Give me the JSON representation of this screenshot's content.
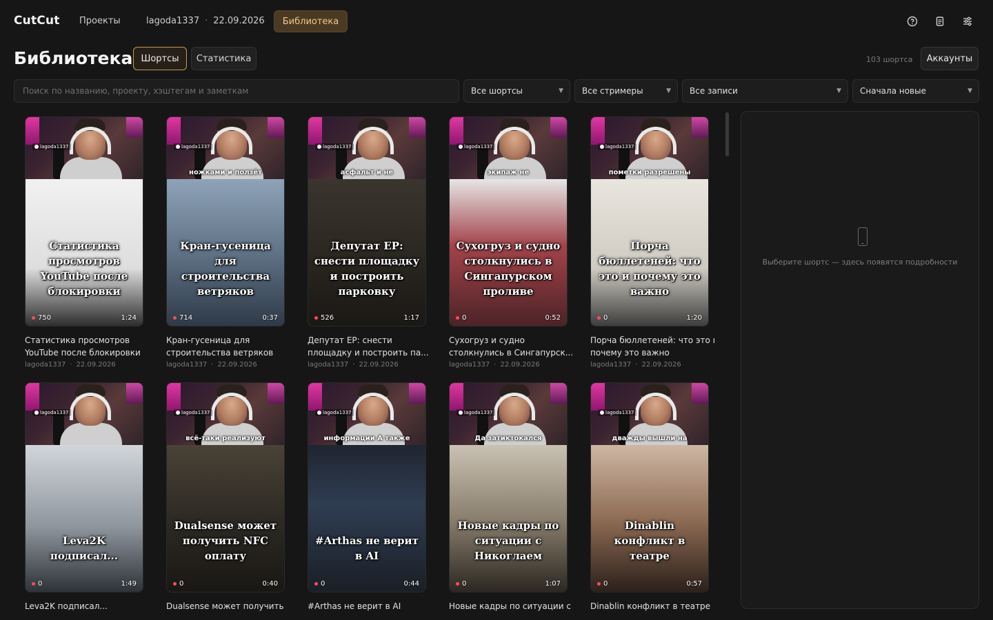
{
  "app": {
    "name": "CutCut"
  },
  "nav": {
    "projects": "Проекты",
    "account": "lagoda1337",
    "date": "22.09.2026",
    "library": "Библиотека"
  },
  "header": {
    "title": "Библиотека",
    "tabs": [
      "Шортсы",
      "Статистика"
    ],
    "count": "103 шортса",
    "accounts_button": "Аккаунты"
  },
  "filters": {
    "search_placeholder": "Поиск по названию, проекту, хэштегам и заметкам",
    "shorts": "Все шортсы",
    "streamers": "Все стримеры",
    "records": "Все записи",
    "sort": "Сначала новые"
  },
  "cards": [
    {
      "strip": "",
      "caption": "Статистика просмотров YouTube после блокировки",
      "views": "750",
      "duration": "1:24",
      "title": "Статистика просмотров YouTube после блокировки",
      "author": "lagoda1337",
      "date": "22.09.2026"
    },
    {
      "strip": "ножками и ползёт",
      "caption": "Кран-гусеница для строительства ветряков",
      "views": "714",
      "duration": "0:37",
      "title": "Кран-гусеница для строительства ветряков",
      "author": "lagoda1337",
      "date": "22.09.2026"
    },
    {
      "strip": "асфальт и не",
      "caption": "Депутат ЕР: снести площадку и построить парковку",
      "views": "526",
      "duration": "1:17",
      "title": "Депутат ЕР: снести площадку и построить па...",
      "author": "lagoda1337",
      "date": "22.09.2026"
    },
    {
      "strip": "экипаж не",
      "caption": "Сухогруз и судно столкнулись в Сингапурском проливе",
      "views": "0",
      "duration": "0:52",
      "title": "Сухогруз и судно столкнулись в Сингапурск...",
      "author": "lagoda1337",
      "date": "22.09.2026"
    },
    {
      "strip": "пометки разрешены",
      "caption": "Порча бюллетеней: что это и почему это важно",
      "views": "0",
      "duration": "1:20",
      "title": "Порча бюллетеней: что это и почему это важно",
      "author": "lagoda1337",
      "date": "22.09.2026"
    },
    {
      "strip": "",
      "caption": "Leva2K подписал...",
      "views": "0",
      "duration": "1:49",
      "title": "Leva2K подписал...",
      "author": "",
      "date": ""
    },
    {
      "strip": "всё-таки реализуют",
      "caption": "Dualsense может получить NFC оплату",
      "views": "0",
      "duration": "0:40",
      "title": "Dualsense может получить",
      "author": "",
      "date": ""
    },
    {
      "strip": "информации А также",
      "caption": "#Arthas не верит в AI",
      "views": "0",
      "duration": "0:44",
      "title": "#Arthas не верит в AI",
      "author": "",
      "date": ""
    },
    {
      "strip": "Да затиктокался",
      "caption": "Новые кадры по ситуации с Никоглаем",
      "views": "0",
      "duration": "1:07",
      "title": "Новые кадры по ситуации с",
      "author": "",
      "date": ""
    },
    {
      "strip": "дважды вышли на",
      "caption": "Dinablin конфликт в театре",
      "views": "0",
      "duration": "0:57",
      "title": "Dinablin конфликт в театре",
      "author": "",
      "date": ""
    }
  ],
  "details": {
    "hint": "Выберите шортс — здесь появятся подробности"
  },
  "icons": [
    "help-icon",
    "document-icon",
    "settings-sliders-icon",
    "phone-icon",
    "chevron-down-icon"
  ],
  "colors": {
    "accent": "#c49a55",
    "accent_bg": "#4a3a23",
    "views_dot": "#ff4a5e",
    "caption_highlight": "#f5c542"
  }
}
